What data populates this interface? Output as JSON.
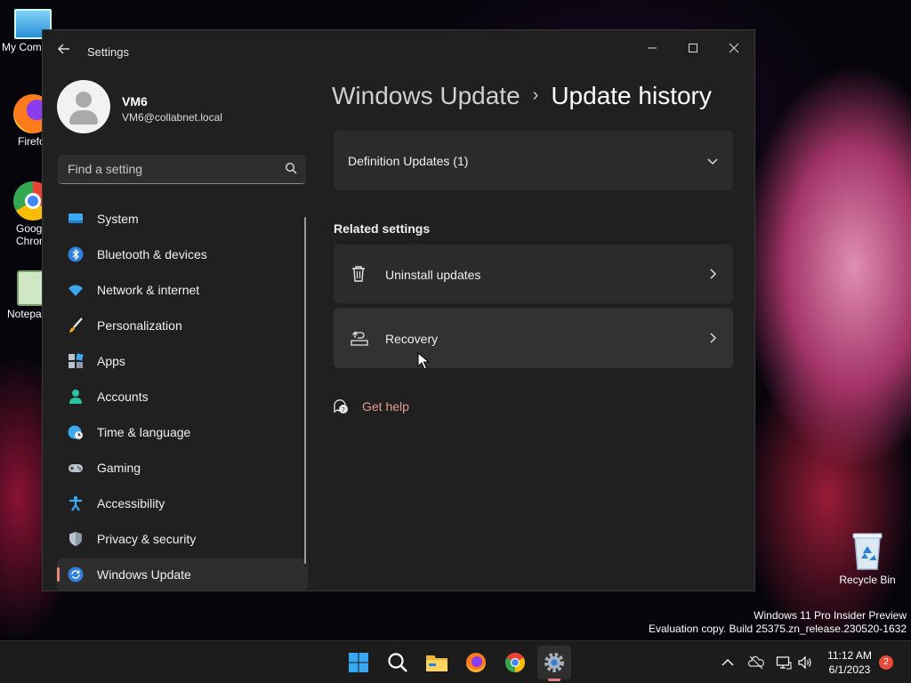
{
  "desktop": {
    "icons": [
      {
        "label": "My Com"
      },
      {
        "label": "Firefo"
      },
      {
        "label": "Goog Chron"
      },
      {
        "label": "Notepa"
      }
    ],
    "recycle_bin": "Recycle Bin",
    "watermark_line1": "Windows 11 Pro Insider Preview",
    "watermark_line2": "Evaluation copy. Build 25375.zn_release.230520-1632"
  },
  "window": {
    "app_title": "Settings",
    "controls": {
      "minimize": "—",
      "maximize": "☐",
      "close": "✕"
    }
  },
  "profile": {
    "name": "VM6",
    "email": "VM6@collabnet.local"
  },
  "search": {
    "placeholder": "Find a setting"
  },
  "sidebar": {
    "items": [
      {
        "label": "System",
        "icon": "monitor-icon"
      },
      {
        "label": "Bluetooth & devices",
        "icon": "bluetooth-icon"
      },
      {
        "label": "Network & internet",
        "icon": "wifi-icon"
      },
      {
        "label": "Personalization",
        "icon": "brush-icon"
      },
      {
        "label": "Apps",
        "icon": "apps-icon"
      },
      {
        "label": "Accounts",
        "icon": "person-icon"
      },
      {
        "label": "Time & language",
        "icon": "globe-clock-icon"
      },
      {
        "label": "Gaming",
        "icon": "gamepad-icon"
      },
      {
        "label": "Accessibility",
        "icon": "accessibility-icon"
      },
      {
        "label": "Privacy & security",
        "icon": "shield-icon"
      },
      {
        "label": "Windows Update",
        "icon": "update-icon",
        "active": true
      }
    ]
  },
  "main": {
    "breadcrumb_parent": "Windows Update",
    "breadcrumb_separator": "›",
    "breadcrumb_current": "Update history",
    "definition_updates": "Definition Updates (1)",
    "related_settings_title": "Related settings",
    "uninstall_updates": "Uninstall updates",
    "recovery": "Recovery",
    "get_help": "Get help"
  },
  "taskbar": {
    "clock_time": "11:12 AM",
    "clock_date": "6/1/2023",
    "notification_count": "2"
  },
  "colors": {
    "accent": "#e8857a",
    "window_bg": "#202020",
    "card_bg": "#2b2b2b",
    "link": "#e89a90"
  }
}
